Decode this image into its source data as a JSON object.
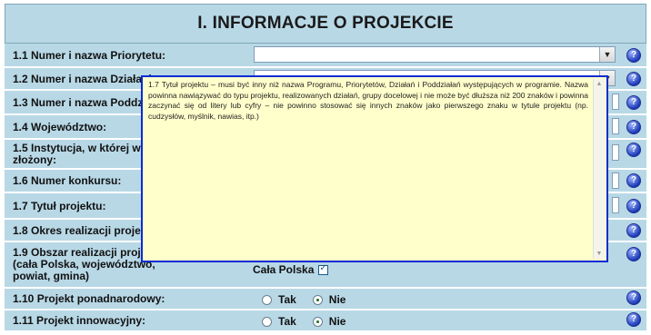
{
  "section_title": "I. INFORMACJE O PROJEKCIE",
  "rows": [
    {
      "label": "1.1 Numer i nazwa Priorytetu:"
    },
    {
      "label": "1.2 Numer i nazwa Działania:"
    },
    {
      "label": "1.3 Numer i nazwa Poddz"
    },
    {
      "label": "1.4 Województwo:"
    },
    {
      "label": "1.5 Instytucja, w której wn"
    },
    {
      "label": "złożony:"
    },
    {
      "label": "1.6 Numer konkursu:"
    },
    {
      "label": "1.7 Tytuł projektu:"
    },
    {
      "label": "1.8 Okres realizacji proje"
    },
    {
      "label": "1.9 Obszar realizacji proje"
    },
    {
      "label": "(cała Polska, województwo,"
    },
    {
      "label": "powiat, gmina)"
    },
    {
      "label": "1.10 Projekt ponadnarodowy:"
    },
    {
      "label": "1.11 Projekt innowacyjny:"
    }
  ],
  "cala_polska_label": "Cała Polska",
  "radio_tak": "Tak",
  "radio_nie": "Nie",
  "help_glyph": "?",
  "popup_text": "1.7 Tytuł projektu – musi być inny niż nazwa Programu, Priorytetów, Działań i Poddziałań występujących w programie. Nazwa powinna nawiązywać do typu projektu, realizowanych działań, grupy docelowej i nie może być dłuższa niż 200 znaków i powinna zaczynać się od litery lub cyfry – nie powinno stosować się innych znaków jako pierwszego znaku w tytule projektu (np. cudzysłów, myślnik, nawias, itp.)",
  "colors": {
    "row_bg": "#b8d8e6",
    "popup_bg": "#ffffcc",
    "popup_border": "#0a2bd6"
  }
}
